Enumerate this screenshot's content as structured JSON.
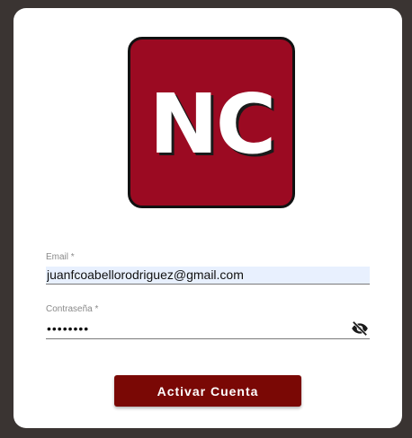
{
  "logo": {
    "text": "NC",
    "background": "#9b0a22"
  },
  "form": {
    "email": {
      "label": "Email *",
      "value": "juanfcoabellorodriguez@gmail.com"
    },
    "password": {
      "label": "Contraseña *",
      "value": "••••••••",
      "toggle_icon": "eye-off-icon"
    },
    "submit_label": "Activar Cuenta",
    "submit_color": "#7a0805"
  }
}
